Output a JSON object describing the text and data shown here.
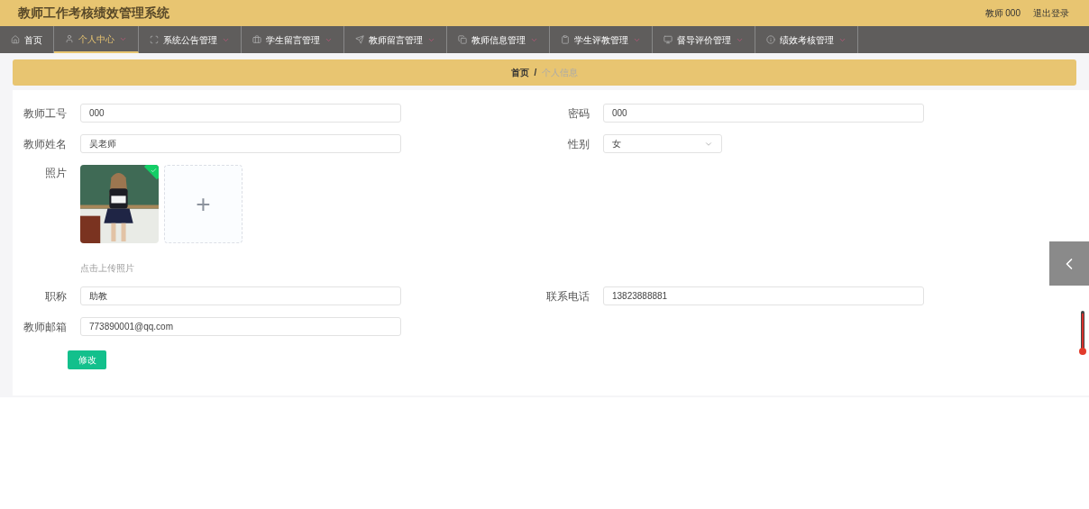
{
  "header": {
    "title": "教师工作考核绩效管理系统",
    "user": "教师 000",
    "logout": "退出登录"
  },
  "nav": [
    {
      "label": "首页",
      "selected": false,
      "dropdown": false
    },
    {
      "label": "个人中心",
      "selected": true,
      "dropdown": true
    },
    {
      "label": "系统公告管理",
      "selected": false,
      "dropdown": true
    },
    {
      "label": "学生留言管理",
      "selected": false,
      "dropdown": true
    },
    {
      "label": "教师留言管理",
      "selected": false,
      "dropdown": true
    },
    {
      "label": "教师信息管理",
      "selected": false,
      "dropdown": true
    },
    {
      "label": "学生评教管理",
      "selected": false,
      "dropdown": true
    },
    {
      "label": "督导评价管理",
      "selected": false,
      "dropdown": true
    },
    {
      "label": "绩效考核管理",
      "selected": false,
      "dropdown": true
    }
  ],
  "breadcrumb": {
    "home": "首页",
    "separator": "/",
    "current": "个人信息"
  },
  "form": {
    "rows": [
      [
        {
          "kind": "input",
          "label": "教师工号",
          "value": "000"
        },
        {
          "kind": "input",
          "label": "密码",
          "value": "000"
        }
      ],
      [
        {
          "kind": "input",
          "label": "教师姓名",
          "value": "吴老师"
        },
        {
          "kind": "select",
          "label": "性别",
          "value": "女"
        }
      ],
      [
        {
          "label": "照片",
          "uploaded": true,
          "add": "+",
          "hint": "点击上传照片"
        }
      ],
      [
        {
          "kind": "input",
          "label": "职称",
          "value": "助教"
        },
        {
          "kind": "input",
          "label": "联系电话",
          "value": "13823888881"
        }
      ],
      [
        {
          "kind": "input",
          "label": "教师邮箱",
          "value": "773890001@qq.com"
        }
      ]
    ],
    "submit": "修改"
  }
}
